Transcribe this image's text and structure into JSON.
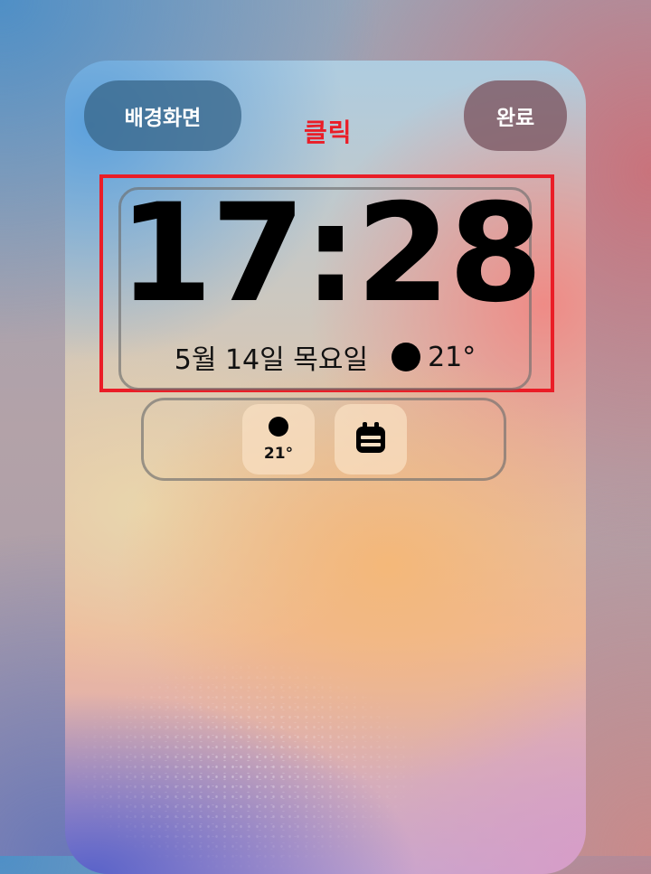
{
  "header": {
    "wallpaper_button": "배경화면",
    "done_button": "완료"
  },
  "annotation": {
    "click_label": "클릭",
    "highlight_color": "#ea1d27"
  },
  "lockscreen": {
    "time": "17:28",
    "date": "5월 14일 목요일",
    "weather_icon": "sun-icon",
    "temperature": "21°"
  },
  "widgets": [
    {
      "type": "weather",
      "icon": "sun-icon",
      "value": "21°"
    },
    {
      "type": "calendar",
      "icon": "calendar-icon"
    }
  ]
}
